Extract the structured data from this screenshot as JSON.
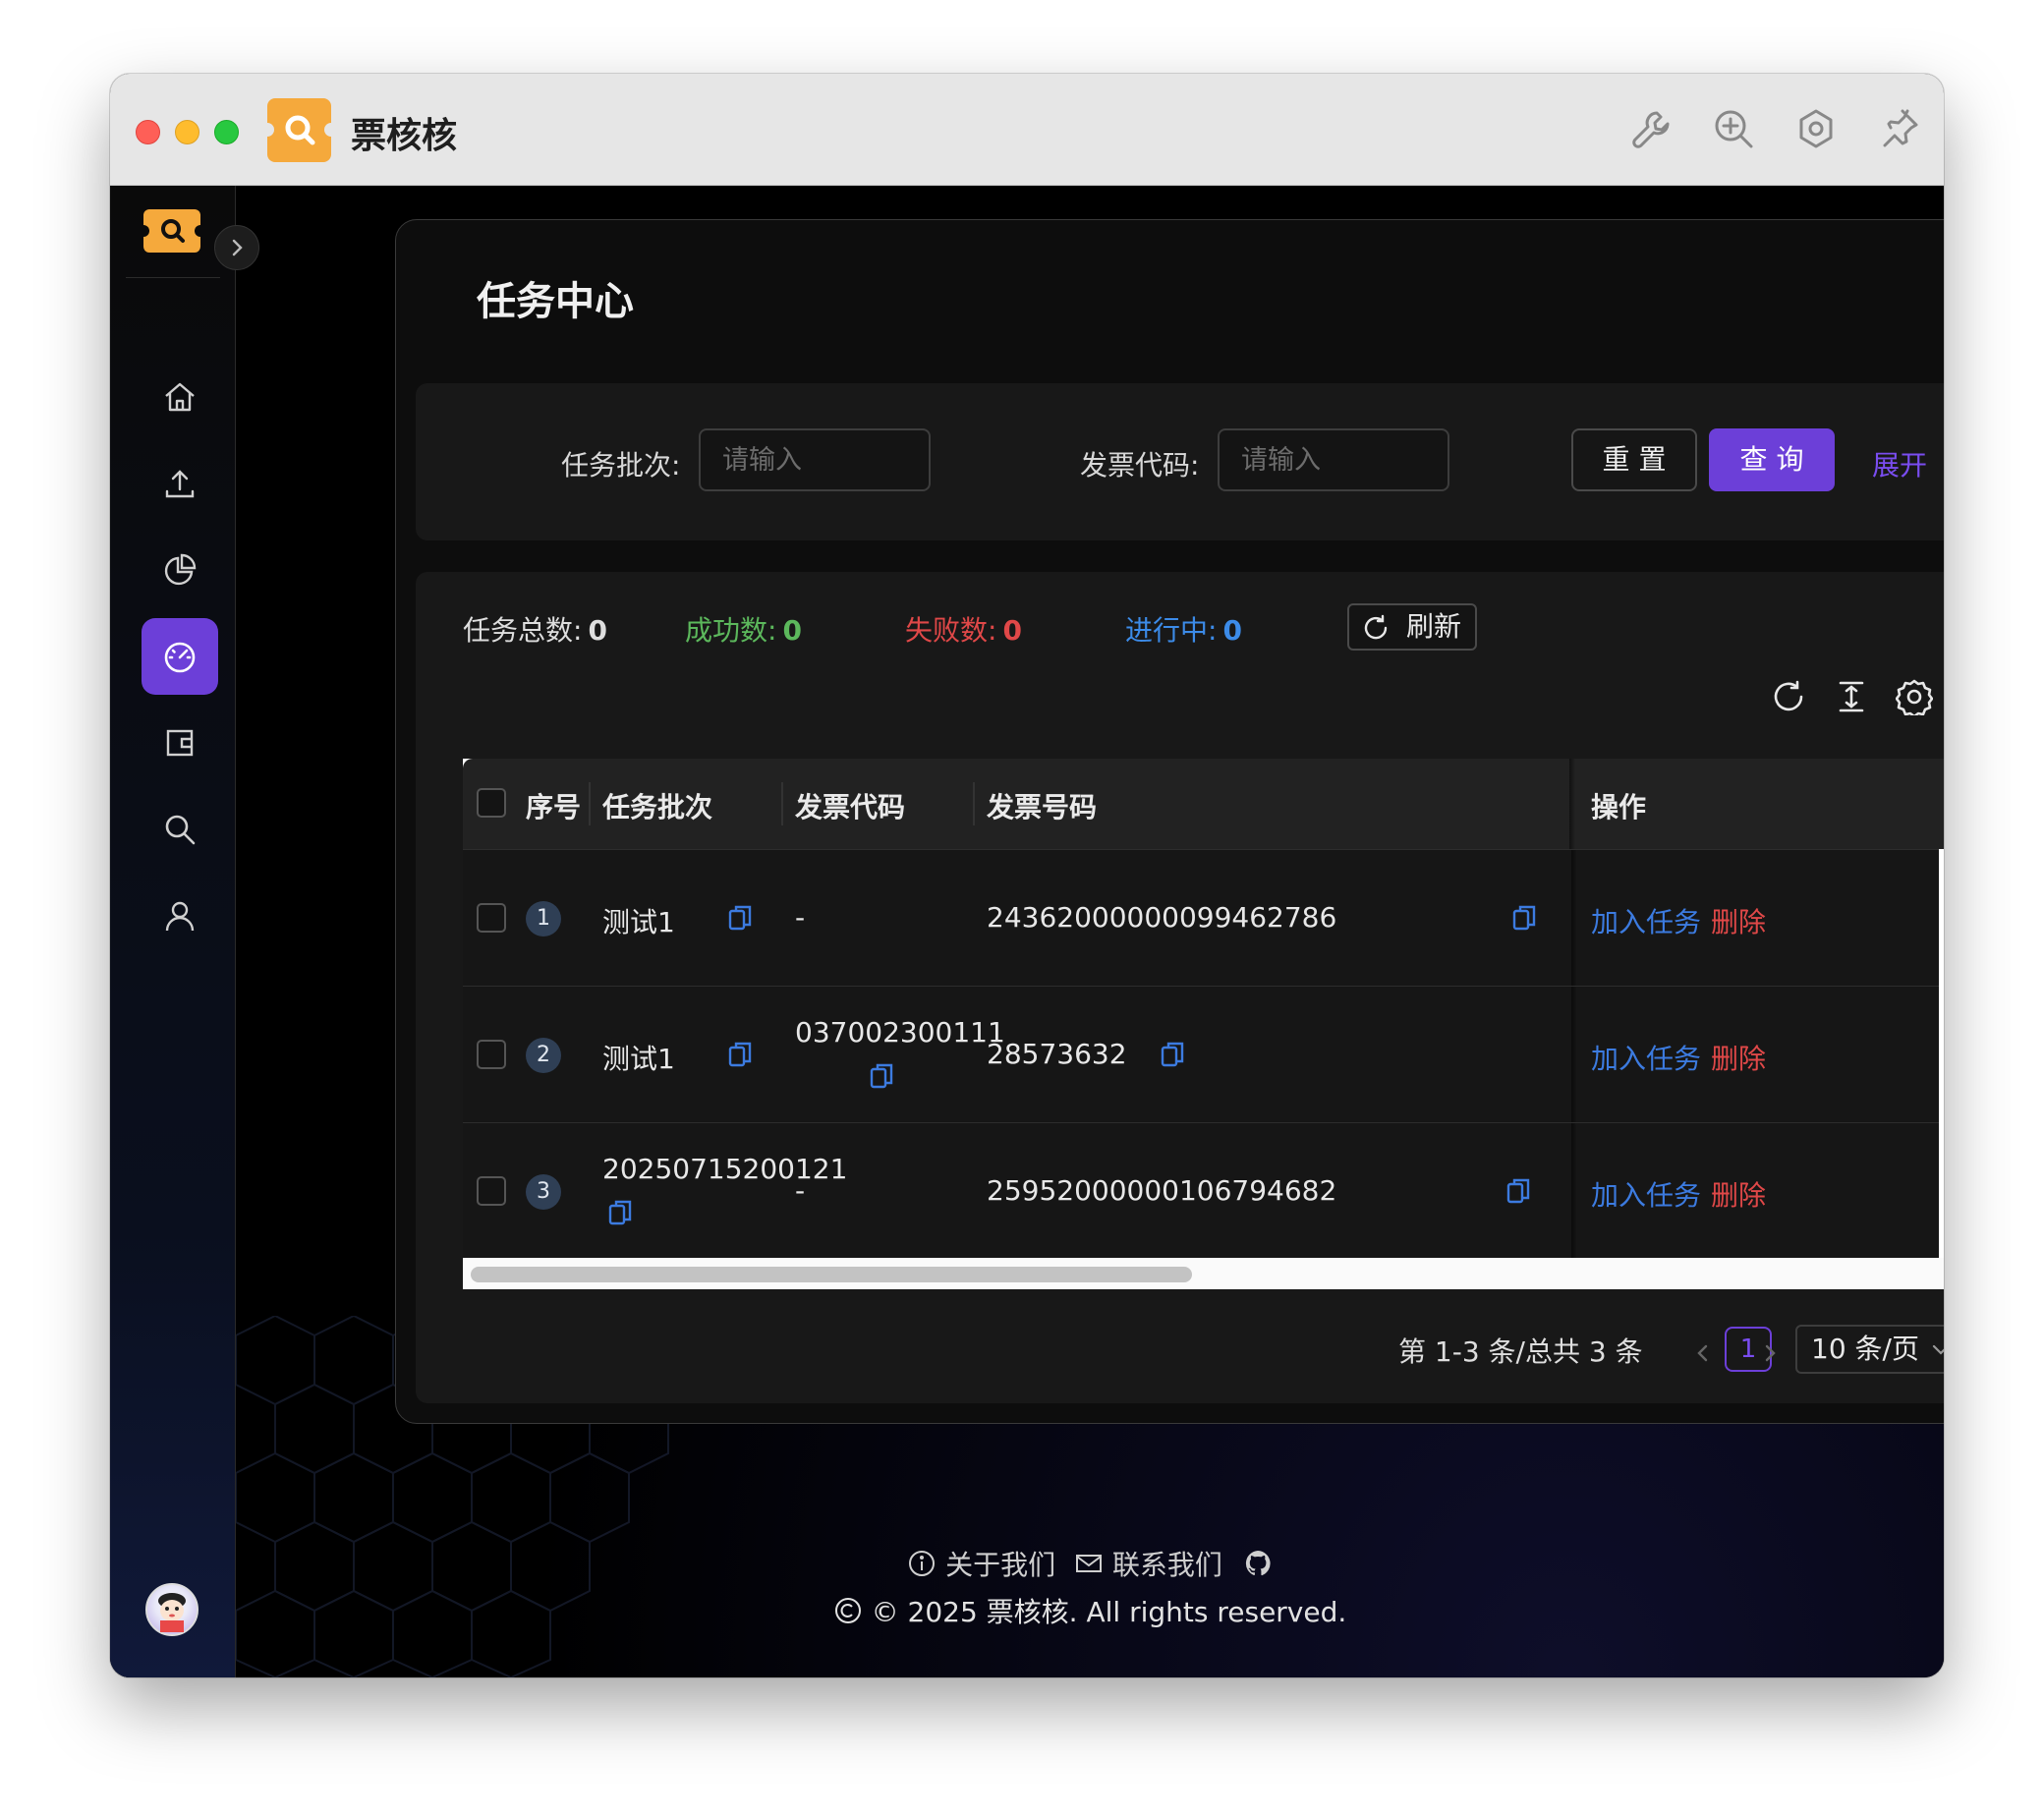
{
  "app": {
    "title": "票核核"
  },
  "page": {
    "title": "任务中心"
  },
  "search": {
    "batch_label": "任务批次:",
    "batch_placeholder": "请输入",
    "code_label": "发票代码:",
    "code_placeholder": "请输入",
    "reset_label": "重 置",
    "query_label": "查 询",
    "expand_label": "展开"
  },
  "stats": {
    "total_label": "任务总数:",
    "total_value": "0",
    "success_label": "成功数:",
    "success_value": "0",
    "failed_label": "失败数:",
    "failed_value": "0",
    "running_label": "进行中:",
    "running_value": "0",
    "refresh_label": "刷新"
  },
  "table": {
    "headers": {
      "index": "序号",
      "batch": "任务批次",
      "code": "发票代码",
      "number": "发票号码",
      "ops": "操作"
    },
    "rows": [
      {
        "index": "1",
        "batch": "测试1",
        "code": "-",
        "number": "24362000000099462786",
        "action_add": "加入任务",
        "action_delete": "删除"
      },
      {
        "index": "2",
        "batch": "测试1",
        "code": "037002300111",
        "number": "28573632",
        "action_add": "加入任务",
        "action_delete": "删除"
      },
      {
        "index": "3",
        "batch": "20250715200121",
        "code": "-",
        "number": "25952000000106794682",
        "action_add": "加入任务",
        "action_delete": "删除"
      }
    ]
  },
  "pagination": {
    "summary": "第 1-3 条/总共 3 条",
    "current_page": "1",
    "page_size": "10 条/页"
  },
  "footer": {
    "about": "关于我们",
    "contact": "联系我们",
    "copyright": "© 2025 票核核. All rights reserved."
  },
  "colors": {
    "accent": "#6c3fd8",
    "success": "#5cb85c",
    "danger": "#e04848",
    "info": "#3c8be8",
    "brand": "#f5a93c"
  },
  "icons": {
    "titlebar": [
      "wrench-icon",
      "zoom-in-icon",
      "hexagon-settings-icon",
      "pin-icon"
    ],
    "sidebar": [
      "home-icon",
      "upload-icon",
      "pie-chart-icon",
      "dashboard-icon",
      "wallet-icon",
      "search-icon",
      "user-icon"
    ],
    "toolbar": [
      "reload-icon",
      "column-height-icon",
      "settings-icon"
    ]
  }
}
